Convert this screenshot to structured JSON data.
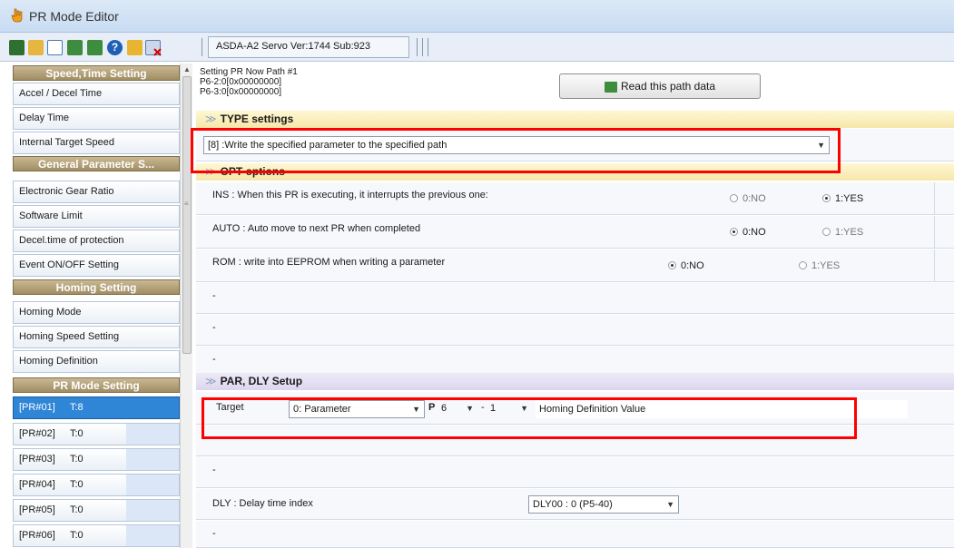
{
  "window": {
    "title": "PR Mode Editor"
  },
  "toolbar": {
    "buttons": [
      "save-icon",
      "open-folder-icon",
      "document-icon",
      "upload-icon",
      "download-icon",
      "help-icon",
      "lock-icon",
      "delete-icon"
    ],
    "version": "ASDA-A2 Servo Ver:1744 Sub:923"
  },
  "sidebar": {
    "headers": [
      "Speed,Time Setting",
      "General Parameter S...",
      "Homing Setting",
      "PR Mode Setting"
    ],
    "speed_items": [
      "Accel / Decel Time",
      "Delay Time",
      "Internal Target Speed"
    ],
    "general_items": [
      "Electronic Gear Ratio",
      "Software Limit",
      "Decel.time of protection",
      "Event ON/OFF Setting"
    ],
    "homing_items": [
      "Homing Mode",
      "Homing Speed Setting",
      "Homing Definition"
    ],
    "pr_items": [
      {
        "code": "[PR#01]",
        "type": "T:8"
      },
      {
        "code": "[PR#02]",
        "type": "T:0"
      },
      {
        "code": "[PR#03]",
        "type": "T:0"
      },
      {
        "code": "[PR#04]",
        "type": "T:0"
      },
      {
        "code": "[PR#05]",
        "type": "T:0"
      },
      {
        "code": "[PR#06]",
        "type": "T:0"
      }
    ]
  },
  "path_info": {
    "line1": "Setting PR Now Path #1",
    "line2": "P6-2:0[0x00000000]",
    "line3": "P6-3:0[0x00000000]"
  },
  "read_button": "Read this path data",
  "type_settings": {
    "header": "TYPE settings",
    "selected": "[8] :Write the specified parameter to the specified path"
  },
  "opt_options": {
    "header": "OPT options",
    "rows": [
      {
        "label": "INS : When this PR is executing, it interrupts the previous one:",
        "no": "0:NO",
        "yes": "1:YES",
        "value": "1"
      },
      {
        "label": "AUTO : Auto move to next PR when completed",
        "no": "0:NO",
        "yes": "1:YES",
        "value": "0"
      },
      {
        "label": "ROM : write into EEPROM when writing a parameter",
        "no": "0:NO",
        "yes": "1:YES",
        "value": "0"
      }
    ],
    "empty_rows": [
      "-",
      "-",
      "-"
    ]
  },
  "par_dly": {
    "header": "PAR, DLY Setup",
    "target_label": "Target",
    "target_type": "0: Parameter",
    "group_prefix": "P",
    "group": "6",
    "sep": "-",
    "index": "1",
    "description": "Homing Definition Value",
    "empty_rows": [
      "-",
      "-"
    ],
    "dly_label": "DLY : Delay time index",
    "dly_value": "DLY00 : 0 (P5-40)",
    "last_row": "-"
  },
  "colors": {
    "highlight": "#ff0000",
    "selected": "#2f86d6"
  }
}
